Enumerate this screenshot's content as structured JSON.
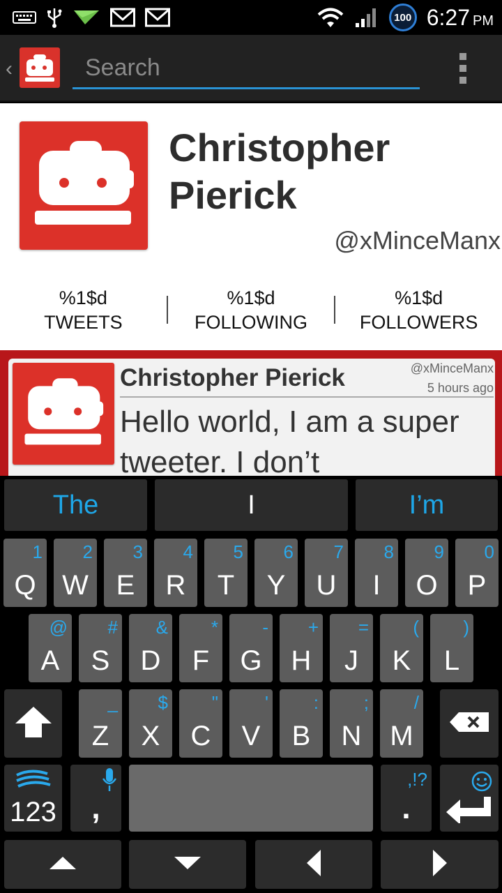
{
  "status_bar": {
    "left_icons": [
      "keyboard-icon",
      "usb-icon",
      "send-icon",
      "gmail-icon",
      "gmail-icon"
    ],
    "battery": "100",
    "time": "6:27",
    "ampm": "PM"
  },
  "action_bar": {
    "back": "‹",
    "search_placeholder": "Search"
  },
  "profile": {
    "name": "Christopher Pierick",
    "handle": "@xMinceManx",
    "stats": [
      {
        "value": "%1$d",
        "label": "TWEETS"
      },
      {
        "value": "%1$d",
        "label": "FOLLOWING"
      },
      {
        "value": "%1$d",
        "label": "FOLLOWERS"
      }
    ]
  },
  "tweet": {
    "name": "Christopher Pierick",
    "handle": "@xMinceManx",
    "time": "5 hours ago",
    "text": "Hello world, I am a super tweeter. I don’t"
  },
  "keyboard": {
    "suggestions": [
      "The",
      "I",
      "I’m"
    ],
    "row1": [
      {
        "l": "Q",
        "a": "1"
      },
      {
        "l": "W",
        "a": "2"
      },
      {
        "l": "E",
        "a": "3"
      },
      {
        "l": "R",
        "a": "4"
      },
      {
        "l": "T",
        "a": "5"
      },
      {
        "l": "Y",
        "a": "6"
      },
      {
        "l": "U",
        "a": "7"
      },
      {
        "l": "I",
        "a": "8"
      },
      {
        "l": "O",
        "a": "9"
      },
      {
        "l": "P",
        "a": "0"
      }
    ],
    "row2": [
      {
        "l": "A",
        "a": "@"
      },
      {
        "l": "S",
        "a": "#"
      },
      {
        "l": "D",
        "a": "&"
      },
      {
        "l": "F",
        "a": "*"
      },
      {
        "l": "G",
        "a": "-"
      },
      {
        "l": "H",
        "a": "+"
      },
      {
        "l": "J",
        "a": "="
      },
      {
        "l": "K",
        "a": "("
      },
      {
        "l": "L",
        "a": ")"
      }
    ],
    "row3": [
      {
        "l": "Z",
        "a": "_"
      },
      {
        "l": "X",
        "a": "$"
      },
      {
        "l": "C",
        "a": "\""
      },
      {
        "l": "V",
        "a": "'"
      },
      {
        "l": "B",
        "a": ":"
      },
      {
        "l": "N",
        "a": ";"
      },
      {
        "l": "M",
        "a": "/"
      }
    ],
    "numbers_label": "123",
    "comma": ",",
    "period": ".",
    "punct_alt": ",!?",
    "accent_color": "#2aa9ec"
  }
}
